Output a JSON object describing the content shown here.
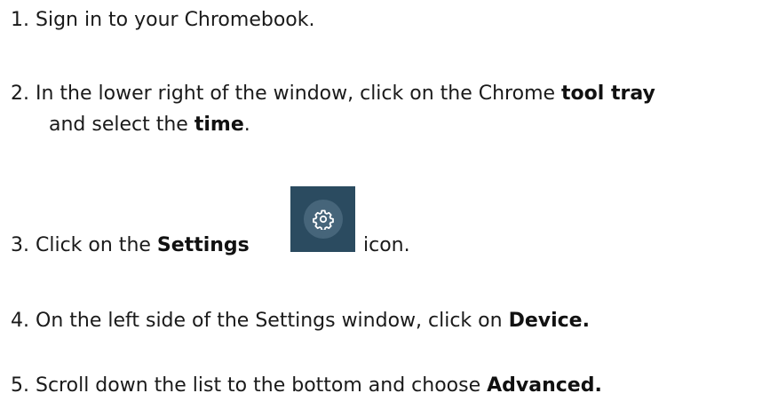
{
  "steps": [
    {
      "number": "1.",
      "text": "Sign in to your Chromebook."
    },
    {
      "number": "2.",
      "before": "In the lower right of the window, click on the Chrome ",
      "bold1": "tool tray",
      "line2_before": "and select the ",
      "bold2": "time",
      "line2_after": "."
    },
    {
      "number": "3.",
      "before": "Click on the ",
      "bold": "Settings",
      "after": "icon.",
      "icon": "settings-gear-icon",
      "icon_bg": "#2b4b60",
      "icon_circle": "#46657a",
      "icon_color": "#ffffff"
    },
    {
      "number": "4.",
      "before": " On the left side of the Settings window, click on ",
      "bold": "Device."
    },
    {
      "number": "5.",
      "before": "Scroll down the list to the bottom and choose ",
      "bold": "Advanced."
    }
  ]
}
